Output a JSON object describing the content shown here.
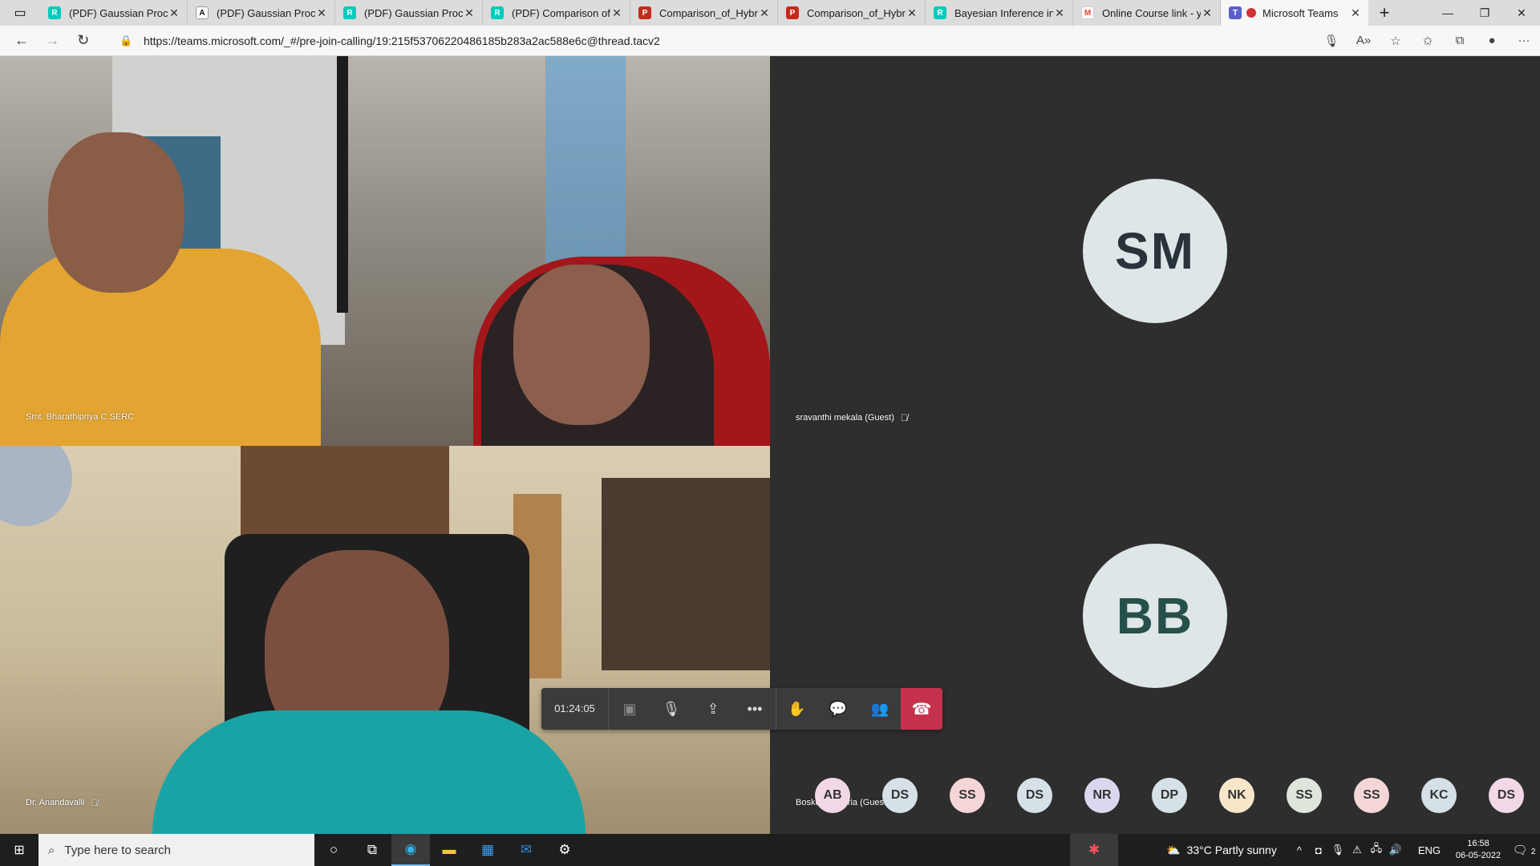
{
  "browser": {
    "tabs": [
      {
        "title": "(PDF) Gaussian Proces",
        "icon": "researchgate-icon",
        "color": "#00ccbb"
      },
      {
        "title": "(PDF) Gaussian Proces",
        "icon": "academia-icon",
        "color": "#ffffff"
      },
      {
        "title": "(PDF) Gaussian Proces",
        "icon": "researchgate-icon",
        "color": "#00ccbb"
      },
      {
        "title": "(PDF) Comparison of h",
        "icon": "researchgate-icon",
        "color": "#00ccbb"
      },
      {
        "title": "Comparison_of_Hybric",
        "icon": "pdf-icon",
        "color": "#c42b1c"
      },
      {
        "title": "Comparison_of_Hybric",
        "icon": "pdf-icon",
        "color": "#c42b1c"
      },
      {
        "title": "Bayesian Inference in",
        "icon": "researchgate-icon",
        "color": "#00ccbb"
      },
      {
        "title": "Online Course link - yo",
        "icon": "gmail-icon",
        "color": "#ea4335"
      },
      {
        "title": "Microsoft Teams",
        "icon": "teams-icon",
        "color": "#5b5fc7"
      }
    ],
    "url": "https://teams.microsoft.com/_#/pre-join-calling/19:215f53706220486185b283a2ac588e6c@thread.tacv2"
  },
  "meeting": {
    "timer": "01:24:05",
    "tiles": [
      {
        "name": "Smt. Bharathipriya C SERC"
      },
      {
        "name": "sravanthi mekala (Guest)",
        "initials": "SM"
      },
      {
        "name": "Dr. Anandavalli"
      },
      {
        "name": "Boskey Bahoria (Guest)",
        "initials": "BB"
      }
    ],
    "participants": [
      {
        "initials": "AB",
        "color": "#f2d7e6"
      },
      {
        "initials": "DS",
        "color": "#d5e1e6"
      },
      {
        "initials": "SS",
        "color": "#f5d6d6"
      },
      {
        "initials": "DS",
        "color": "#d5e1e6"
      },
      {
        "initials": "NR",
        "color": "#dcd7ef"
      },
      {
        "initials": "DP",
        "color": "#d5e1e6"
      },
      {
        "initials": "NK",
        "color": "#f7e6c9"
      },
      {
        "initials": "SS",
        "color": "#dfe5db"
      },
      {
        "initials": "SS",
        "color": "#f5d6d6"
      },
      {
        "initials": "KC",
        "color": "#d5e1e6"
      },
      {
        "initials": "DS",
        "color": "#f2d7e6"
      }
    ]
  },
  "taskbar": {
    "search_placeholder": "Type here to search",
    "weather": "33°C  Partly sunny",
    "lang": "ENG",
    "time": "16:58",
    "date": "06-05-2022",
    "notifications": "2"
  }
}
